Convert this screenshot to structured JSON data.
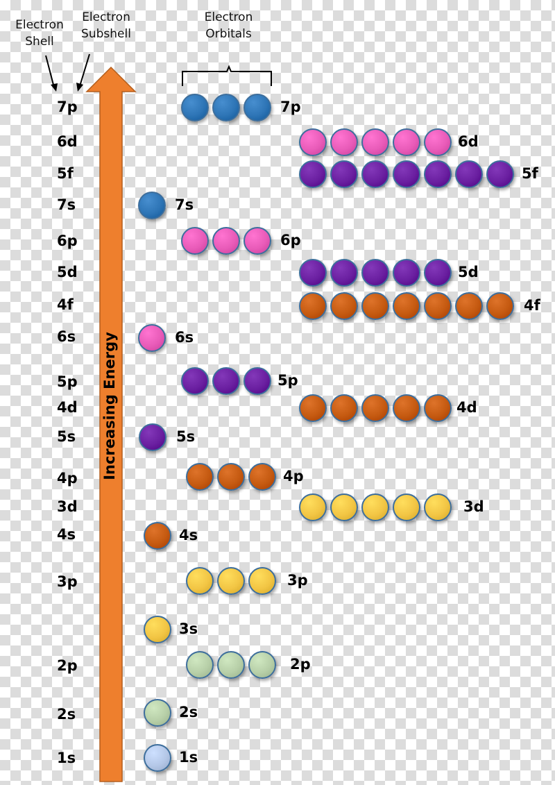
{
  "headers": {
    "shell": [
      "Electron",
      "Shell"
    ],
    "subshell": [
      "Electron",
      "Subshell"
    ],
    "orbitals": [
      "Electron",
      "Orbitals"
    ]
  },
  "arrow_label": "Increasing Energy",
  "colors": {
    "arrow": "#ee7f2d",
    "blue": "#2e75b6",
    "pink": "#e85bb8",
    "purple": "#6a1fa0",
    "rust": "#c55a11",
    "gold": "#f2c544",
    "sage": "#b7cfa8",
    "lightblue": "#b4c7e7"
  },
  "subshells": [
    {
      "name": "7p",
      "orbitals": 3,
      "color": "blue"
    },
    {
      "name": "6d",
      "orbitals": 5,
      "color": "pink"
    },
    {
      "name": "5f",
      "orbitals": 7,
      "color": "purple"
    },
    {
      "name": "7s",
      "orbitals": 1,
      "color": "blue"
    },
    {
      "name": "6p",
      "orbitals": 3,
      "color": "pink"
    },
    {
      "name": "5d",
      "orbitals": 5,
      "color": "purple"
    },
    {
      "name": "4f",
      "orbitals": 7,
      "color": "rust"
    },
    {
      "name": "6s",
      "orbitals": 1,
      "color": "pink"
    },
    {
      "name": "5p",
      "orbitals": 3,
      "color": "purple"
    },
    {
      "name": "4d",
      "orbitals": 5,
      "color": "rust"
    },
    {
      "name": "5s",
      "orbitals": 1,
      "color": "purple"
    },
    {
      "name": "4p",
      "orbitals": 3,
      "color": "rust"
    },
    {
      "name": "3d",
      "orbitals": 5,
      "color": "gold"
    },
    {
      "name": "4s",
      "orbitals": 1,
      "color": "rust"
    },
    {
      "name": "3p",
      "orbitals": 3,
      "color": "gold"
    },
    {
      "name": "3s",
      "orbitals": 1,
      "color": "gold"
    },
    {
      "name": "2p",
      "orbitals": 3,
      "color": "sage"
    },
    {
      "name": "2s",
      "orbitals": 1,
      "color": "sage"
    },
    {
      "name": "1s",
      "orbitals": 1,
      "color": "lightblue"
    }
  ]
}
